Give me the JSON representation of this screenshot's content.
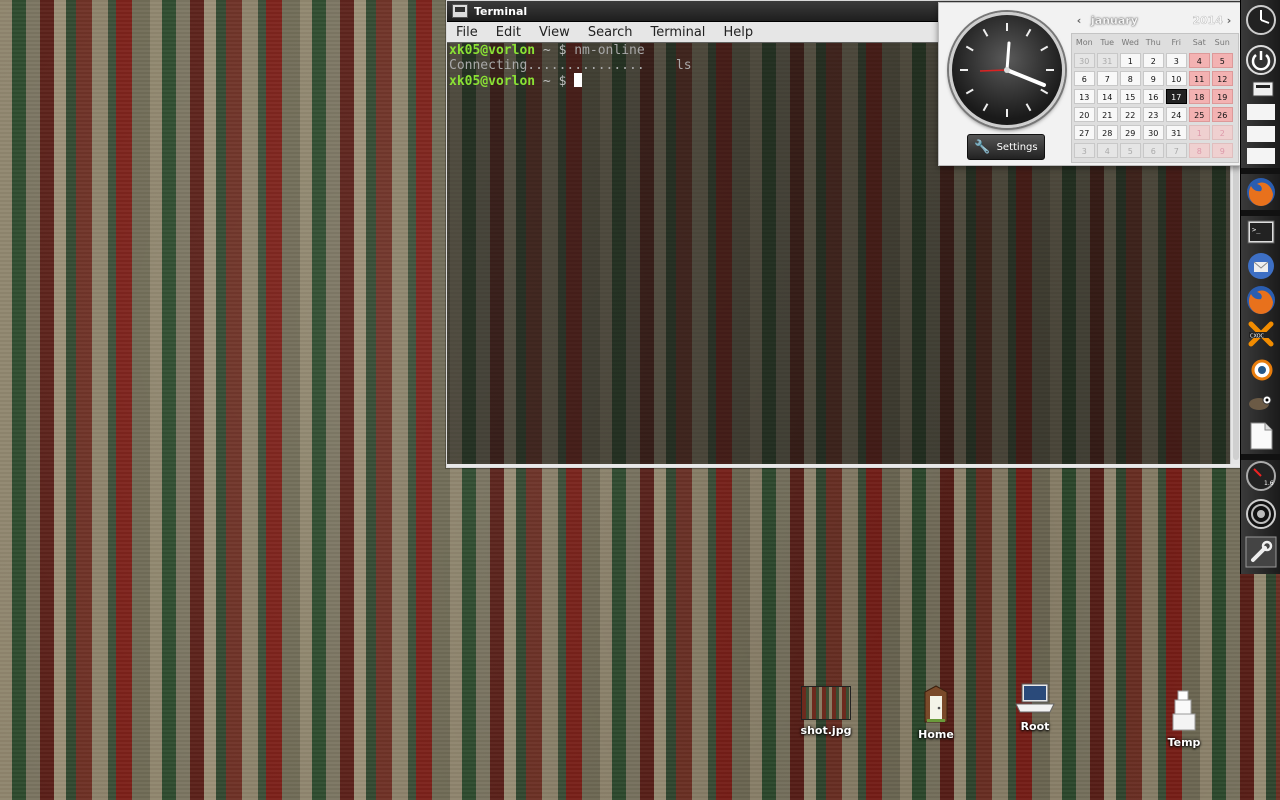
{
  "terminal": {
    "title": "Terminal",
    "menu": [
      "File",
      "Edit",
      "View",
      "Search",
      "Terminal",
      "Help"
    ],
    "lines": {
      "l1_user": "xk05@vorlon",
      "l1_path": " ~ $ ",
      "l1_cmd": "nm-online",
      "l2_text": "Connecting...............    ls",
      "l3_user": "xk05@vorlon",
      "l3_path": " ~ $ "
    }
  },
  "calendar": {
    "month": "january",
    "year": "2014",
    "prev": "‹",
    "next": "›",
    "days_of_week": [
      "Mon",
      "Tue",
      "Wed",
      "Thu",
      "Fri",
      "Sat",
      "Sun"
    ],
    "weeks": [
      [
        "30",
        "31",
        "1",
        "2",
        "3",
        "4",
        "5"
      ],
      [
        "6",
        "7",
        "8",
        "9",
        "10",
        "11",
        "12"
      ],
      [
        "13",
        "14",
        "15",
        "16",
        "17",
        "18",
        "19"
      ],
      [
        "20",
        "21",
        "22",
        "23",
        "24",
        "25",
        "26"
      ],
      [
        "27",
        "28",
        "29",
        "30",
        "31",
        "1",
        "2"
      ],
      [
        "3",
        "4",
        "5",
        "6",
        "7",
        "8",
        "9"
      ]
    ],
    "today": "17"
  },
  "clock": {
    "settings_label": "Settings",
    "time_shown": "4:20"
  },
  "desktop_icons": [
    {
      "label": "shot.jpg",
      "icon": "image-icon"
    },
    {
      "label": "Home",
      "icon": "home-door-icon"
    },
    {
      "label": "Root",
      "icon": "laptop-icon"
    },
    {
      "label": "Temp",
      "icon": "boxes-icon"
    }
  ],
  "dock": {
    "items": [
      "clock-icon",
      "power-icon",
      "storage-icon",
      "blank-icon",
      "blank-icon",
      "blank-icon",
      "firefox-icon",
      "terminal-icon",
      "thunderbird-icon",
      "firefox-icon",
      "crossover-icon",
      "blender-icon",
      "gimp-icon",
      "document-icon",
      "gauge-icon",
      "speaker-icon",
      "settings-wrench-icon"
    ],
    "gauge_value": "1.6"
  },
  "colors": {
    "prompt_green": "#8ae234",
    "weekend_pink": "#f3b2b2",
    "today_dark": "#222222"
  }
}
